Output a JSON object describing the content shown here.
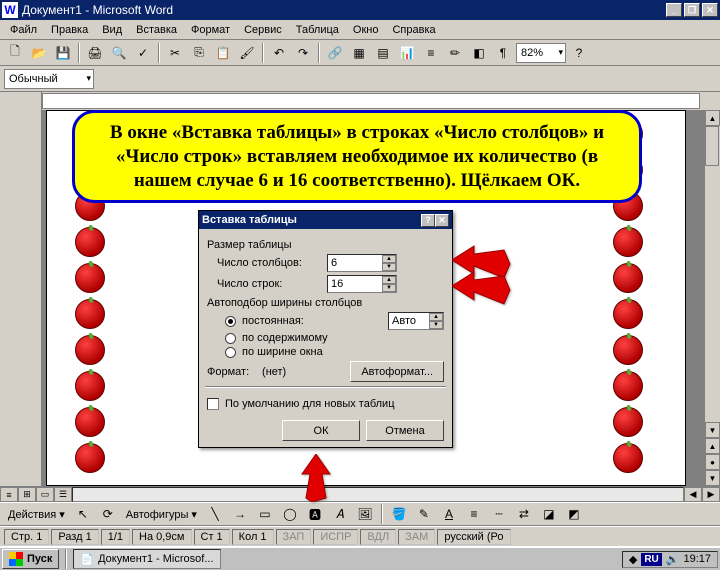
{
  "titlebar": {
    "app_icon": "W",
    "title": "Документ1 - Microsoft Word"
  },
  "menus": [
    "Файл",
    "Правка",
    "Вид",
    "Вставка",
    "Формат",
    "Сервис",
    "Таблица",
    "Окно",
    "Справка"
  ],
  "format_toolbar": {
    "style": "Обычный",
    "zoom": "82%"
  },
  "callout": "В окне «Вставка таблицы» в строках «Число столбцов» и «Число строк» вставляем необходимое их количество (в нашем случае 6 и 16 соответственно). Щёлкаем ОК.",
  "dialog": {
    "title": "Вставка таблицы",
    "group_size": "Размер таблицы",
    "cols_label": "Число столбцов:",
    "cols_value": "6",
    "rows_label": "Число строк:",
    "rows_value": "16",
    "group_autofit": "Автоподбор ширины столбцов",
    "radio_fixed": "постоянная:",
    "fixed_value": "Авто",
    "radio_content": "по содержимому",
    "radio_window": "по ширине окна",
    "format_label": "Формат:",
    "format_value": "(нет)",
    "autoformat_btn": "Автоформат...",
    "default_chk": "По умолчанию для новых таблиц",
    "ok": "ОК",
    "cancel": "Отмена"
  },
  "drawbar": {
    "actions": "Действия",
    "autoshapes": "Автофигуры"
  },
  "status": {
    "page": "Стр. 1",
    "section": "Разд 1",
    "pages": "1/1",
    "at": "На 0,9см",
    "line": "Ст 1",
    "col": "Кол 1",
    "rec": "ЗАП",
    "trk": "ИСПР",
    "ext": "ВДЛ",
    "ovr": "ЗАМ",
    "lang": "русский (Ро"
  },
  "taskbar": {
    "start": "Пуск",
    "task": "Документ1 - Microsof...",
    "lang": "RU",
    "time": "19:17"
  }
}
